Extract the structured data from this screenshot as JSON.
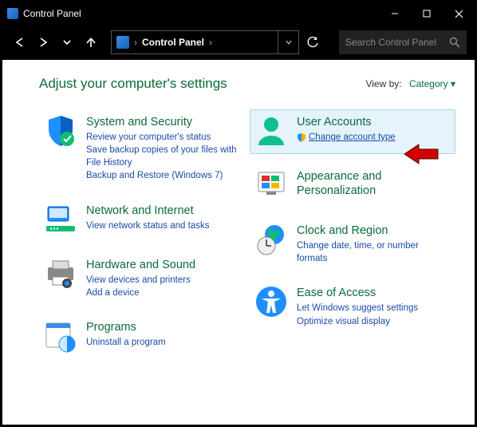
{
  "window": {
    "title": "Control Panel"
  },
  "addressbar": {
    "path": "Control Panel",
    "sep": "›"
  },
  "search": {
    "placeholder": "Search Control Panel"
  },
  "header": {
    "heading": "Adjust your computer's settings",
    "viewby_label": "View by:",
    "viewby_value": "Category"
  },
  "left": {
    "sys": {
      "title": "System and Security",
      "l1": "Review your computer's status",
      "l2": "Save backup copies of your files with File History",
      "l3": "Backup and Restore (Windows 7)"
    },
    "net": {
      "title": "Network and Internet",
      "l1": "View network status and tasks"
    },
    "hw": {
      "title": "Hardware and Sound",
      "l1": "View devices and printers",
      "l2": "Add a device"
    },
    "prog": {
      "title": "Programs",
      "l1": "Uninstall a program"
    }
  },
  "right": {
    "user": {
      "title": "User Accounts",
      "l1": "Change account type"
    },
    "app": {
      "title": "Appearance and Personalization"
    },
    "clock": {
      "title": "Clock and Region",
      "l1": "Change date, time, or number formats"
    },
    "ease": {
      "title": "Ease of Access",
      "l1": "Let Windows suggest settings",
      "l2": "Optimize visual display"
    }
  }
}
